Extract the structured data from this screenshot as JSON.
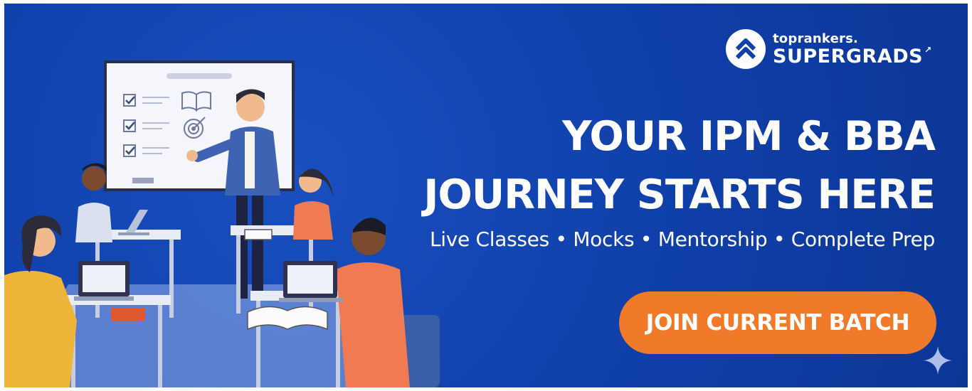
{
  "brand": {
    "small": "toprankers.",
    "big": "SUPERGRADS",
    "arrow": "↗"
  },
  "headline": {
    "line1": "YOUR IPM & BBA",
    "line2": "JOURNEY STARTS HERE"
  },
  "subtitle": "Live Classes • Mocks • Mentorship • Complete Prep",
  "cta": {
    "label": "JOIN CURRENT BATCH"
  },
  "colors": {
    "background": "#0f3fa8",
    "cta": "#f07a2a",
    "text": "#ffffff"
  },
  "icons": [
    "logo-chevron-icon",
    "checkbox-icon",
    "book-icon",
    "target-icon",
    "laptop-icon",
    "sparkle-icon"
  ]
}
